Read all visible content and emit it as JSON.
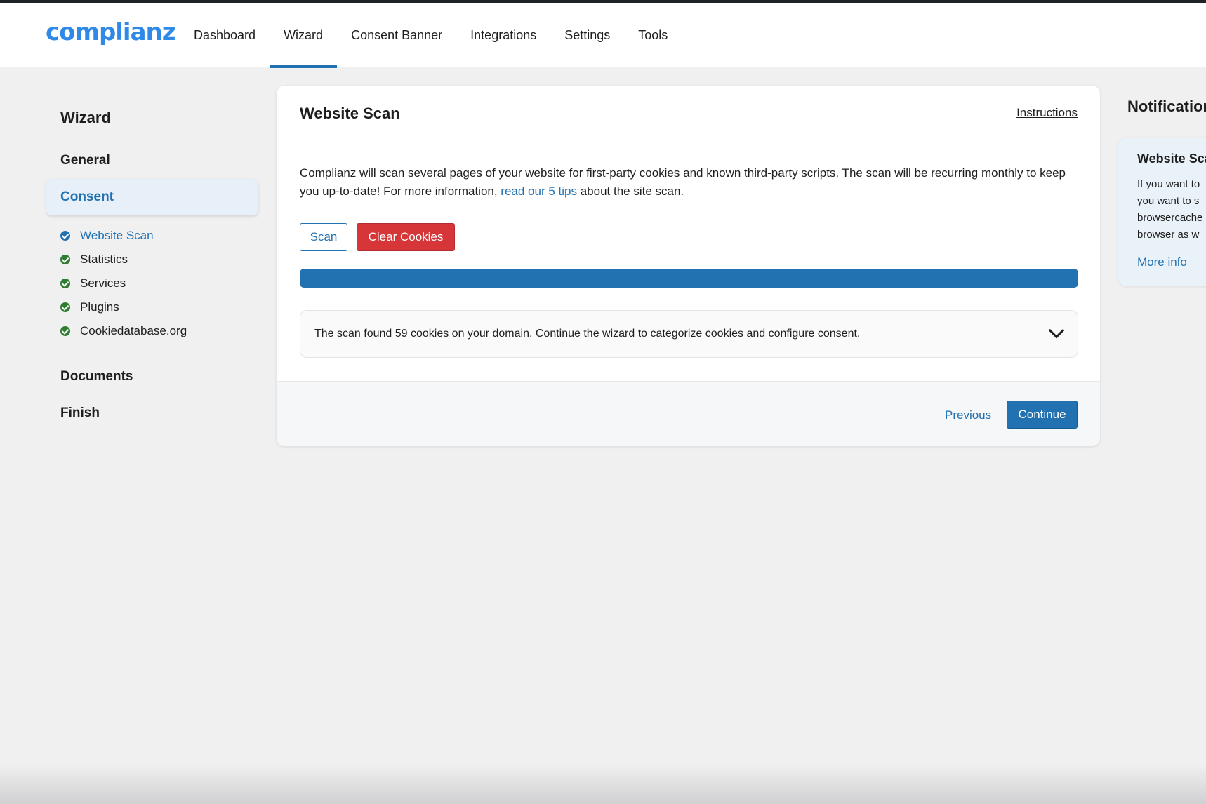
{
  "brand": {
    "logo_text": "complianz",
    "accent": "#2271b1",
    "logo_color": "#2e8ae6"
  },
  "nav": {
    "items": [
      {
        "label": "Dashboard"
      },
      {
        "label": "Wizard",
        "active": true
      },
      {
        "label": "Consent Banner"
      },
      {
        "label": "Integrations"
      },
      {
        "label": "Settings"
      },
      {
        "label": "Tools"
      }
    ]
  },
  "sidebar": {
    "title": "Wizard",
    "sections": {
      "general": "General",
      "consent": "Consent",
      "documents": "Documents",
      "finish": "Finish"
    },
    "steps": [
      {
        "label": "Website Scan",
        "icon": "check-circle-icon",
        "active": true
      },
      {
        "label": "Statistics",
        "icon": "check-circle-icon"
      },
      {
        "label": "Services",
        "icon": "check-circle-icon"
      },
      {
        "label": "Plugins",
        "icon": "check-circle-icon"
      },
      {
        "label": "Cookiedatabase.org",
        "icon": "check-circle-icon"
      }
    ]
  },
  "main": {
    "title": "Website Scan",
    "instructions_link": "Instructions",
    "description_part1": "Complianz will scan several pages of your website for first-party cookies and known third-party scripts. The scan will be recurring monthly to keep you up-to-date! For more information, ",
    "description_link": "read our 5 tips",
    "description_part2": " about the site scan.",
    "scan_button": "Scan",
    "clear_button": "Clear Cookies",
    "progress_percent": 100,
    "result_text": "The scan found 59 cookies on your domain. Continue the wizard to categorize cookies and configure consent.",
    "previous_link": "Previous",
    "continue_button": "Continue"
  },
  "notifications": {
    "title": "Notification",
    "card_title": "Website Sca",
    "card_lines": [
      "If you want to",
      "you want to s",
      "browsercache",
      "browser as w"
    ],
    "more_info": "More info"
  }
}
